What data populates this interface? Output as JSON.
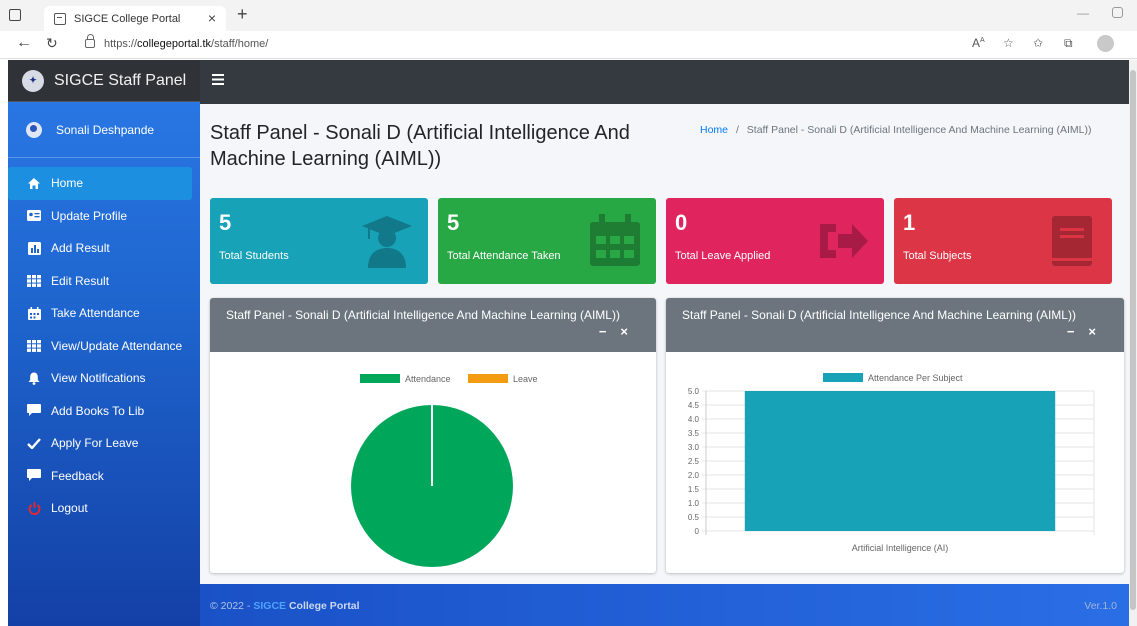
{
  "browser": {
    "tab_title": "SIGCE College Portal",
    "url_prefix": "https://",
    "url_domain": "collegeportal.tk",
    "url_path": "/staff/home/"
  },
  "sidebar": {
    "brand": "SIGCE Staff Panel",
    "user_name": "Sonali Deshpande",
    "items": [
      {
        "label": "Home",
        "icon": "home-icon"
      },
      {
        "label": "Update Profile",
        "icon": "id-card-icon"
      },
      {
        "label": "Add Result",
        "icon": "chart-icon"
      },
      {
        "label": "Edit Result",
        "icon": "grid-icon"
      },
      {
        "label": "Take Attendance",
        "icon": "calendar-icon"
      },
      {
        "label": "View/Update Attendance",
        "icon": "grid-icon"
      },
      {
        "label": "View Notifications",
        "icon": "bell-icon"
      },
      {
        "label": "Add Books To Lib",
        "icon": "comment-icon"
      },
      {
        "label": "Apply For Leave",
        "icon": "check-icon"
      },
      {
        "label": "Feedback",
        "icon": "comment-icon"
      },
      {
        "label": "Logout",
        "icon": "power-icon"
      }
    ]
  },
  "header": {
    "page_title": "Staff Panel - Sonali D (Artificial Intelligence And Machine Learning (AIML))",
    "breadcrumb_home": "Home",
    "breadcrumb_separator": "/",
    "breadcrumb_current": "Staff Panel - Sonali D (Artificial Intelligence And Machine Learning (AIML))"
  },
  "stats": [
    {
      "value": "5",
      "label": "Total Students",
      "color": "#17a2b8",
      "icon": "graduate-icon"
    },
    {
      "value": "5",
      "label": "Total Attendance Taken",
      "color": "#28a745",
      "icon": "calendar-icon"
    },
    {
      "value": "0",
      "label": "Total Leave Applied",
      "color": "#e0245e",
      "icon": "sign-out-icon"
    },
    {
      "value": "1",
      "label": "Total Subjects",
      "color": "#dc3545",
      "icon": "book-icon"
    }
  ],
  "cards": {
    "left_title": "Staff Panel - Sonali D (Artificial Intelligence And Machine Learning (AIML))",
    "right_title": "Staff Panel - Sonali D (Artificial Intelligence And Machine Learning (AIML))",
    "minimize": "−",
    "close": "×"
  },
  "chart_data": [
    {
      "type": "pie",
      "legend": [
        "Attendance",
        "Leave"
      ],
      "colors": [
        "#00a65a",
        "#f39c12"
      ],
      "values": [
        5,
        0
      ]
    },
    {
      "type": "bar",
      "legend": [
        "Attendance Per Subject"
      ],
      "categories": [
        "Artificial Intelligence (AI)"
      ],
      "values": [
        5
      ],
      "color": "#17a2b8",
      "ylim": [
        0,
        5.0
      ],
      "yticks": [
        "0",
        "0.5",
        "1.0",
        "1.5",
        "2.0",
        "2.5",
        "3.0",
        "3.5",
        "4.0",
        "4.5",
        "5.0"
      ]
    }
  ],
  "footer": {
    "copyright": "© 2022 -",
    "brand": "SIGCE",
    "portal": "College Portal",
    "version": "Ver.1.0"
  }
}
